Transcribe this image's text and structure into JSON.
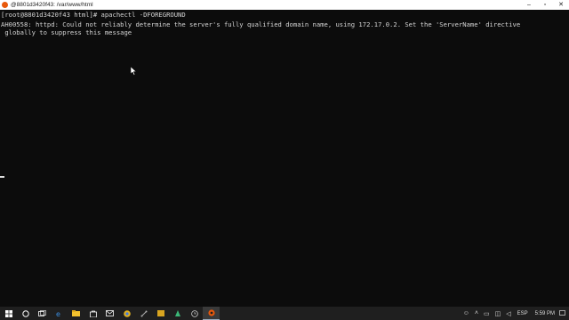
{
  "window": {
    "title": "@8801d3420f43: /var/www/html",
    "controls": {
      "minimize": "–",
      "maximize": "▫",
      "close": "✕"
    }
  },
  "terminal": {
    "lines": [
      "[root@8801d3420f43 html]# apachectl -DFOREGROUND",
      "AH00558: httpd: Could not reliably determine the server's fully qualified domain name, using 172.17.0.2. Set the 'ServerName' directive",
      " globally to suppress this message"
    ]
  },
  "taskbar": {
    "icons": [
      {
        "name": "windows-start-icon",
        "color": "#ffffff"
      },
      {
        "name": "search-icon",
        "color": "#ffffff"
      },
      {
        "name": "task-view-icon",
        "color": "#ffffff"
      },
      {
        "name": "edge-browser-icon",
        "color": "#3b8ee0"
      },
      {
        "name": "file-explorer-icon",
        "color": "#f2c12e"
      },
      {
        "name": "store-icon",
        "color": "#ffffff"
      },
      {
        "name": "mail-icon",
        "color": "#ffffff"
      },
      {
        "name": "chrome-icon",
        "color": "#e0b020"
      },
      {
        "name": "app-icon-git",
        "color": "#b0b0b0"
      },
      {
        "name": "app-icon-folder",
        "color": "#d9a520"
      },
      {
        "name": "app-icon-green",
        "color": "#3cb878"
      },
      {
        "name": "app-icon-clock",
        "color": "#cfcfcf"
      },
      {
        "name": "terminal-app-icon",
        "color": "#e8590c"
      }
    ],
    "tray": {
      "language": "ESP",
      "time": "5:59 PM"
    }
  }
}
